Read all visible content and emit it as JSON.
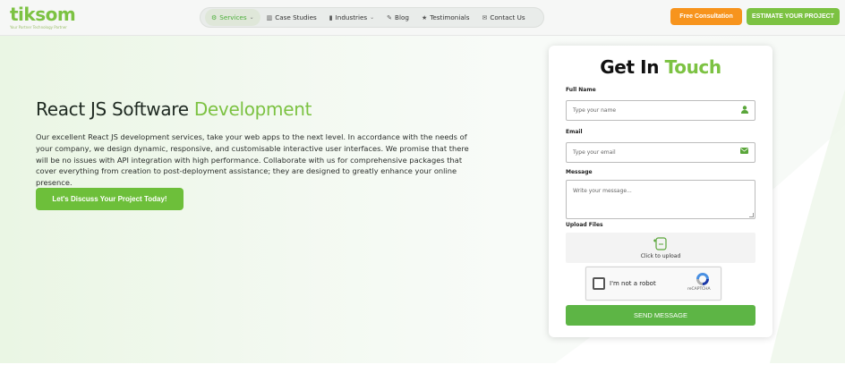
{
  "brand": {
    "logo_text": "tiksom",
    "tagline": "Your Partner Technology Partner"
  },
  "nav": {
    "items": [
      {
        "label": "Services",
        "icon": "gear-icon",
        "active": true,
        "dropdown": true
      },
      {
        "label": "Case Studies",
        "icon": "book-icon",
        "active": false,
        "dropdown": false
      },
      {
        "label": "Industries",
        "icon": "chart-icon",
        "active": false,
        "dropdown": true
      },
      {
        "label": "Blog",
        "icon": "pen-icon",
        "active": false,
        "dropdown": false
      },
      {
        "label": "Testimonials",
        "icon": "star-icon",
        "active": false,
        "dropdown": false
      },
      {
        "label": "Contact Us",
        "icon": "mail-icon",
        "active": false,
        "dropdown": false
      }
    ]
  },
  "header_actions": {
    "free_consultation": "Free Consultation",
    "estimate_project": "ESTIMATE YOUR PROJECT"
  },
  "hero": {
    "title_main": "React JS Software ",
    "title_accent": "Development",
    "description": "Our excellent React JS development services, take your web apps to the next level. In accordance with the needs of your company, we design dynamic, responsive, and customisable interactive user interfaces. We promise that there will be no issues with API integration with high performance. Collaborate with us for comprehensive packages that cover everything from creation to post-deployment assistance; they are designed to greatly enhance your online presence.",
    "cta": "Let's Discuss Your Project Today!"
  },
  "form": {
    "title_main": "Get In ",
    "title_accent": "Touch",
    "full_name_label": "Full Name",
    "full_name_placeholder": "Type your name",
    "email_label": "Email",
    "email_placeholder": "Type your email",
    "message_label": "Message",
    "message_placeholder": "Write your message...",
    "upload_label": "Upload Files",
    "upload_text": "Click to upload",
    "captcha_text": "I'm not a robot",
    "captcha_brand": "reCAPTCHA",
    "submit": "SEND MESSAGE"
  },
  "colors": {
    "accent_green": "#7cc242",
    "orange": "#f7941d",
    "send_green": "#5db545"
  }
}
